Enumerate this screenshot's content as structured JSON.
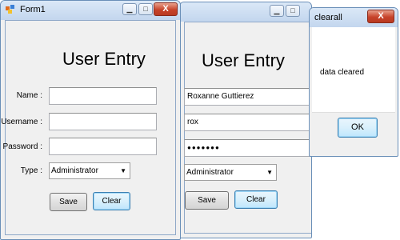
{
  "form1": {
    "title": "Form1",
    "minimize_glyph": "▁",
    "maximize_glyph": "□",
    "close_glyph": "X",
    "heading": "User Entry",
    "name_label": "Name :",
    "username_label": "Username :",
    "password_label": "Password :",
    "type_label": "Type :",
    "name_value": "",
    "username_value": "",
    "password_value": "",
    "type_value": "Administrator",
    "dropdown_glyph": "▼",
    "save_label": "Save",
    "clear_label": "Clear"
  },
  "form2": {
    "minimize_glyph": "▁",
    "maximize_glyph": "□",
    "heading": "User Entry",
    "name_value": "Roxanne Guttierez",
    "username_value": "rox",
    "password_value": "●●●●●●●",
    "type_value": "Administrator",
    "dropdown_glyph": "▼",
    "save_label": "Save",
    "clear_label": "Clear"
  },
  "dialog": {
    "title": "clearall",
    "close_glyph": "X",
    "message": "data cleared",
    "ok_label": "OK"
  },
  "colors": {
    "titlebar": "#c3d6ee",
    "close_button": "#c7432a",
    "window_bg": "#f0f0f0",
    "focus_border": "#3c7fb1"
  }
}
